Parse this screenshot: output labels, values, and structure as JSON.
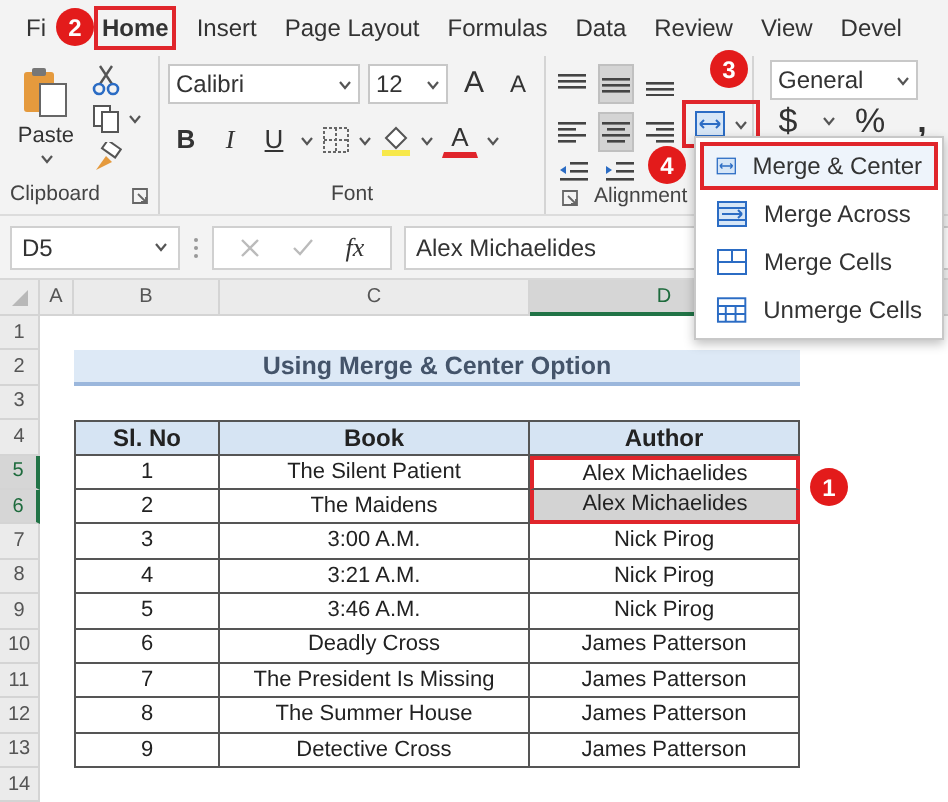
{
  "ribbon_tabs": [
    {
      "label": "Fi",
      "selected": false
    },
    {
      "label": "Home",
      "selected": true
    },
    {
      "label": "Insert",
      "selected": false
    },
    {
      "label": "Page Layout",
      "selected": false
    },
    {
      "label": "Formulas",
      "selected": false
    },
    {
      "label": "Data",
      "selected": false
    },
    {
      "label": "Review",
      "selected": false
    },
    {
      "label": "View",
      "selected": false
    },
    {
      "label": "Devel",
      "selected": false
    }
  ],
  "clipboard": {
    "paste_label": "Paste",
    "group_label": "Clipboard"
  },
  "font": {
    "name": "Calibri",
    "size": "12",
    "grow": "A",
    "shrink": "A",
    "bold": "B",
    "italic": "I",
    "underline": "U",
    "color_letter": "A",
    "group_label": "Font"
  },
  "alignment": {
    "vertical": [
      {
        "selected": false
      },
      {
        "selected": true
      },
      {
        "selected": false
      }
    ],
    "horizontal": [
      {
        "selected": false
      },
      {
        "selected": true
      },
      {
        "selected": false
      }
    ],
    "merge_highlighted": true,
    "group_label": "Alignment"
  },
  "number": {
    "format": "General",
    "currency": "$",
    "percent": "%",
    "comma": ","
  },
  "merge_menu": [
    {
      "label": "Merge & Center",
      "selected": true
    },
    {
      "label": "Merge Across",
      "selected": false
    },
    {
      "label": "Merge Cells",
      "selected": false
    },
    {
      "label": "Unmerge Cells",
      "selected": false
    }
  ],
  "formula_bar": {
    "name_box": "D5",
    "fx": "fx",
    "value": "Alex Michaelides"
  },
  "sheet": {
    "columns": [
      {
        "label": "A",
        "selected": false
      },
      {
        "label": "B",
        "selected": false
      },
      {
        "label": "C",
        "selected": false
      },
      {
        "label": "D",
        "selected": true
      }
    ],
    "row_numbers": [
      {
        "label": "1",
        "selected": false
      },
      {
        "label": "2",
        "selected": false
      },
      {
        "label": "3",
        "selected": false
      },
      {
        "label": "4",
        "selected": false
      },
      {
        "label": "5",
        "selected": true
      },
      {
        "label": "6",
        "selected": true
      },
      {
        "label": "7",
        "selected": false
      },
      {
        "label": "8",
        "selected": false
      },
      {
        "label": "9",
        "selected": false
      },
      {
        "label": "10",
        "selected": false
      },
      {
        "label": "11",
        "selected": false
      },
      {
        "label": "12",
        "selected": false
      },
      {
        "label": "13",
        "selected": false
      },
      {
        "label": "14",
        "selected": false
      }
    ],
    "title": "Using Merge & Center Option",
    "table": {
      "columns": [
        "Sl. No",
        "Book",
        "Author"
      ],
      "rows": [
        {
          "cells": [
            "1",
            "The Silent Patient",
            "Alex Michaelides"
          ],
          "selected": true
        },
        {
          "cells": [
            "2",
            "The Maidens",
            "Alex Michaelides"
          ],
          "selected": true
        },
        {
          "cells": [
            "3",
            "3:00 A.M.",
            "Nick Pirog"
          ],
          "selected": false
        },
        {
          "cells": [
            "4",
            "3:21 A.M.",
            "Nick Pirog"
          ],
          "selected": false
        },
        {
          "cells": [
            "5",
            "3:46 A.M.",
            "Nick Pirog"
          ],
          "selected": false
        },
        {
          "cells": [
            "6",
            "Deadly Cross",
            "James Patterson"
          ],
          "selected": false
        },
        {
          "cells": [
            "7",
            "The President Is Missing",
            "James Patterson"
          ],
          "selected": false
        },
        {
          "cells": [
            "8",
            "The Summer House",
            "James Patterson"
          ],
          "selected": false
        },
        {
          "cells": [
            "9",
            "Detective Cross",
            "James Patterson"
          ],
          "selected": false
        }
      ]
    }
  },
  "callouts": [
    {
      "number": "1"
    },
    {
      "number": "2"
    },
    {
      "number": "3"
    },
    {
      "number": "4"
    }
  ]
}
